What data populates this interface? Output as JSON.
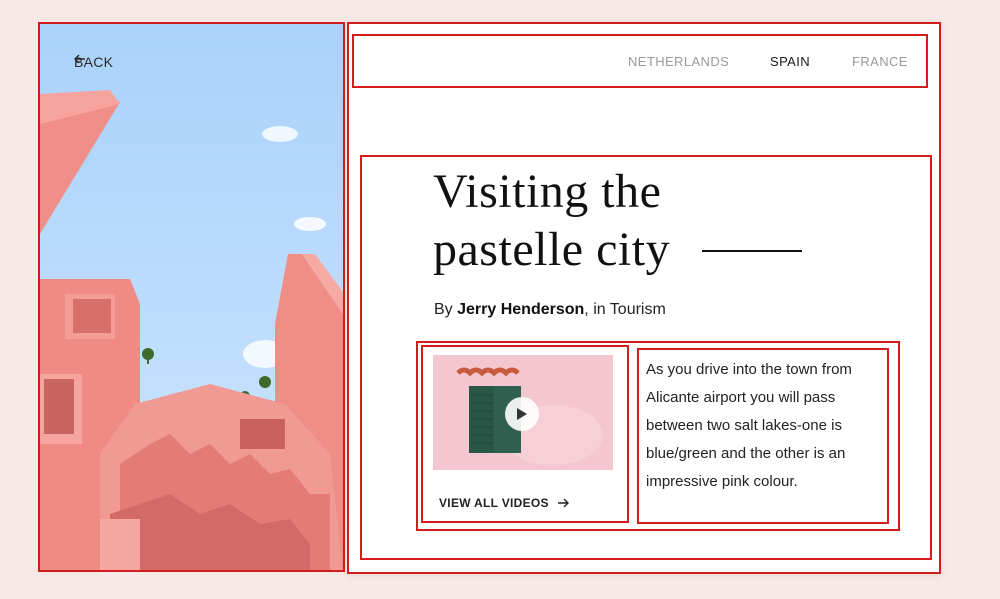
{
  "header": {
    "back_label": "BACK"
  },
  "nav": {
    "items": [
      "NETHERLANDS",
      "SPAIN",
      "FRANCE"
    ],
    "active": "SPAIN"
  },
  "article": {
    "title_line1": "Visiting the",
    "title_line2": "pastelle city",
    "byline_prefix": "By ",
    "author": "Jerry Henderson",
    "byline_suffix": ", in Tourism",
    "body": "As you drive into the town from Alicante airport you will pass between two salt lakes-one is blue/green and the other is an impressive pink colour."
  },
  "video": {
    "view_all_label": "VIEW ALL VIDEOS"
  },
  "icons": {
    "back": "arrow-left-icon",
    "play": "play-icon",
    "view_all": "arrow-right-icon"
  },
  "colors": {
    "outline": "#d31d1d",
    "background": "#f8e9e6",
    "nav_inactive": "#9a9a9a",
    "nav_active": "#1a1a1a"
  }
}
